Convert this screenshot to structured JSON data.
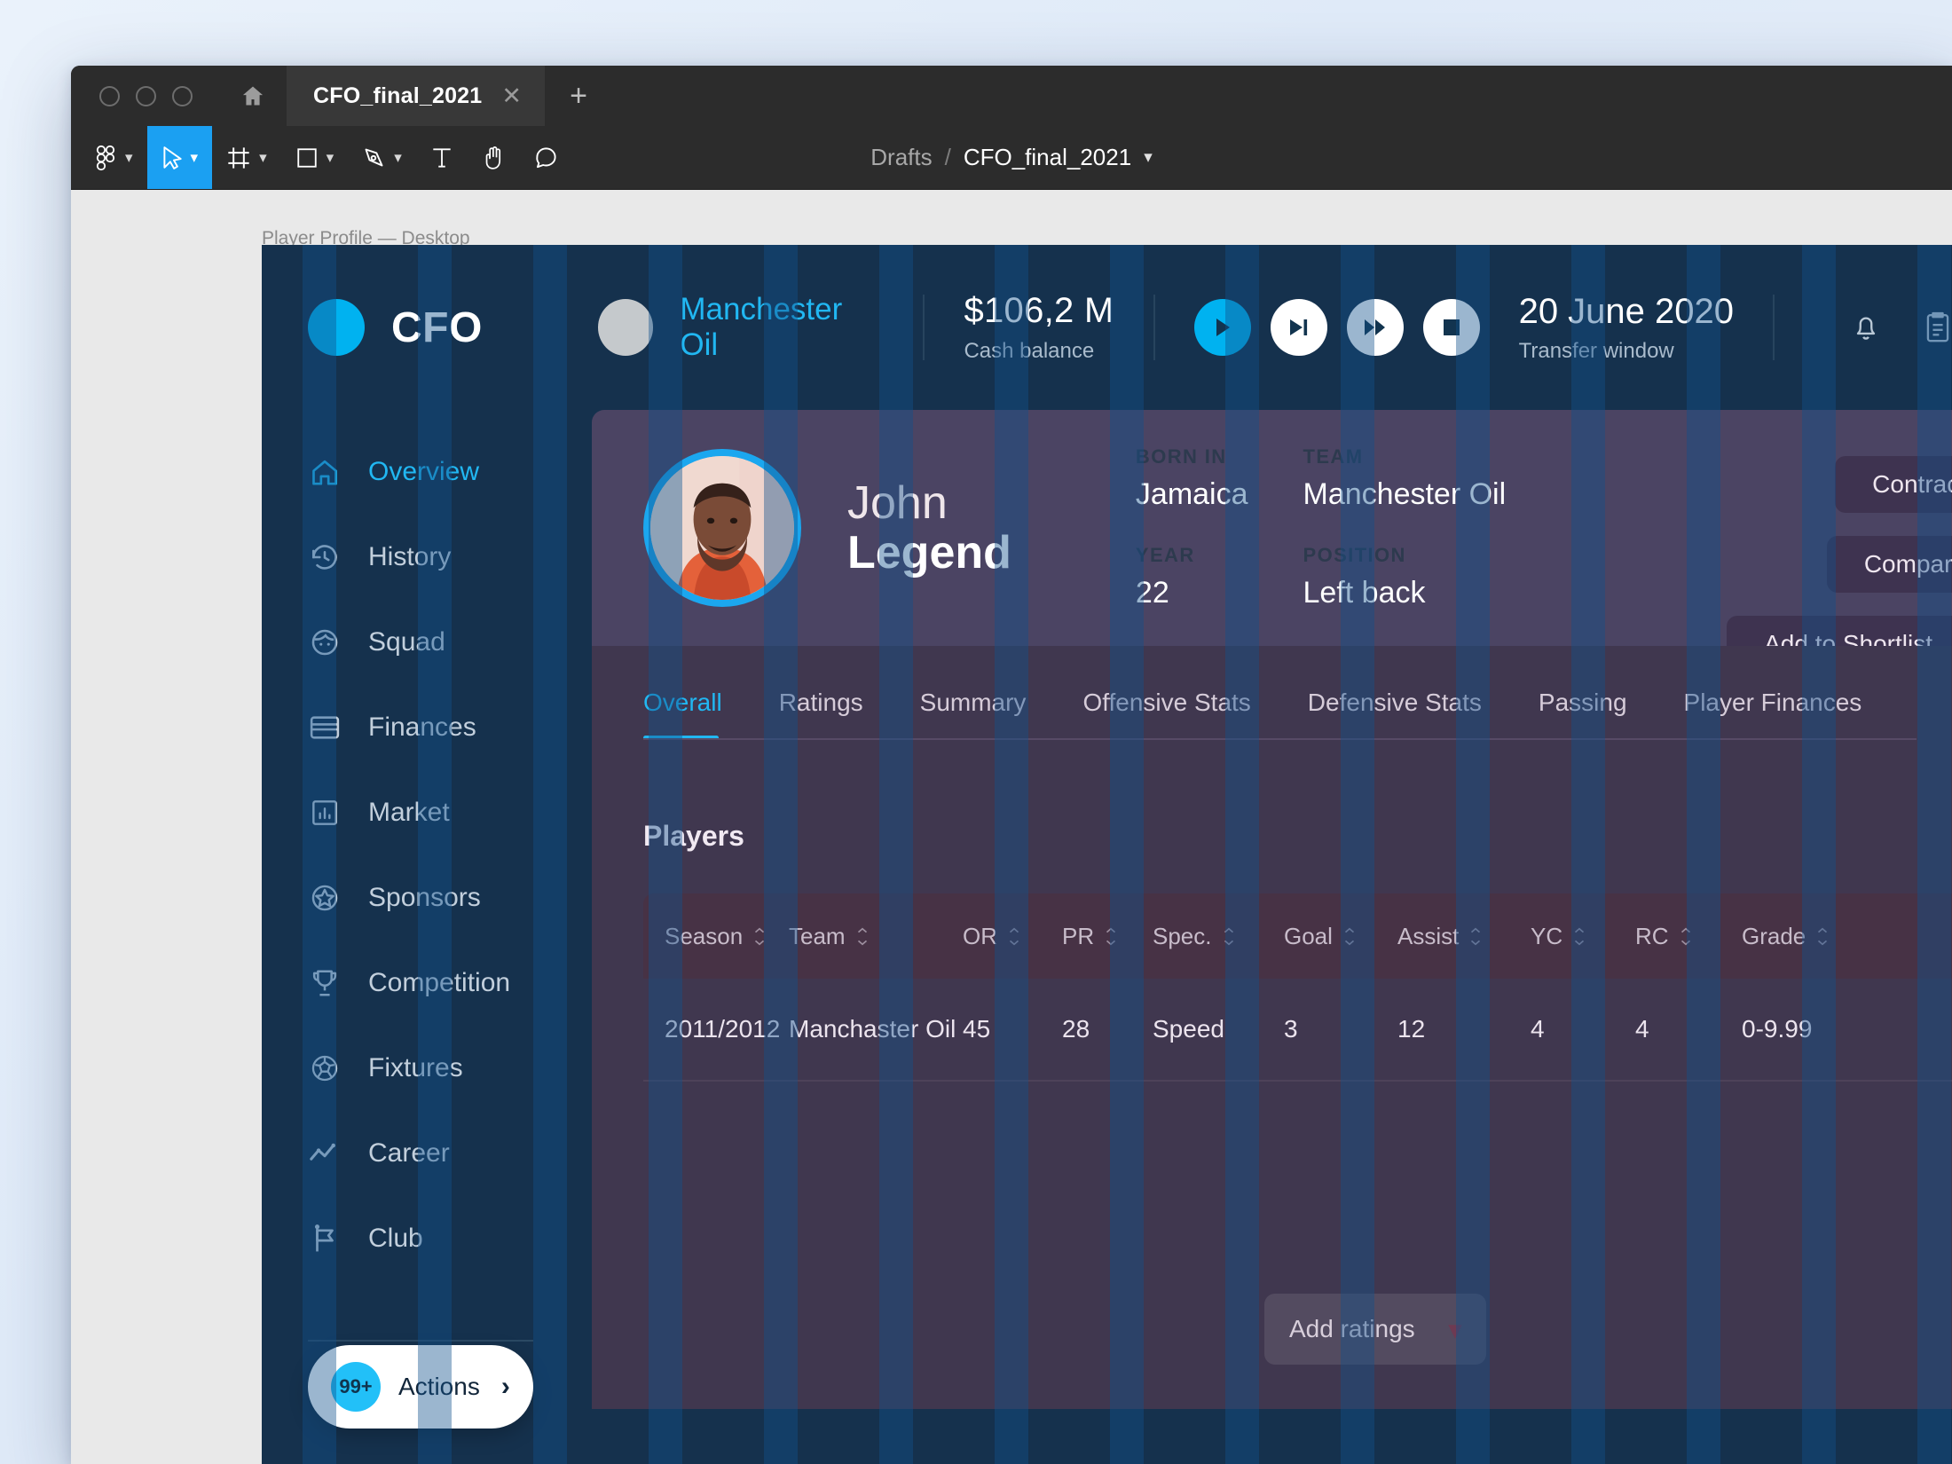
{
  "figma": {
    "tab_title": "CFO_final_2021",
    "close_icon": "close-icon",
    "new_tab_icon": "plus-icon",
    "home_icon": "home-icon",
    "breadcrumb": {
      "project": "Drafts",
      "separator": "/",
      "file": "CFO_final_2021"
    },
    "tools": [
      {
        "name": "figma-menu-icon",
        "caret": true
      },
      {
        "name": "move-tool-icon",
        "caret": true,
        "active": true
      },
      {
        "name": "frame-tool-icon",
        "caret": true
      },
      {
        "name": "shape-tool-icon",
        "caret": true
      },
      {
        "name": "pen-tool-icon",
        "caret": true
      },
      {
        "name": "text-tool-icon",
        "caret": false
      },
      {
        "name": "hand-tool-icon",
        "caret": false
      },
      {
        "name": "comment-tool-icon",
        "caret": false
      }
    ],
    "frame_label": "Player Profile — Desktop"
  },
  "header": {
    "logo_text": "CFO",
    "club_name": "Manchester Oil",
    "cash_value": "$106,2 M",
    "cash_label": "Cash balance",
    "transport": [
      {
        "name": "play-button",
        "icon": "play-icon"
      },
      {
        "name": "step-forward-button",
        "icon": "skip-next-icon"
      },
      {
        "name": "fast-forward-button",
        "icon": "fast-forward-icon"
      },
      {
        "name": "stop-button",
        "icon": "stop-icon"
      }
    ],
    "date_value": "20 June 2020",
    "date_label": "Transfer window",
    "icons": [
      {
        "name": "notifications-bell-icon"
      },
      {
        "name": "clipboard-icon"
      }
    ]
  },
  "sidebar": {
    "items": [
      {
        "label": "Overview",
        "icon": "home-icon",
        "active": true
      },
      {
        "label": "History",
        "icon": "history-icon",
        "active": false
      },
      {
        "label": "Squad",
        "icon": "face-icon",
        "active": false
      },
      {
        "label": "Finances",
        "icon": "credit-card-icon",
        "active": false
      },
      {
        "label": "Market",
        "icon": "bar-chart-icon",
        "active": false
      },
      {
        "label": "Sponsors",
        "icon": "star-badge-icon",
        "active": false
      },
      {
        "label": "Competition",
        "icon": "trophy-icon",
        "active": false
      },
      {
        "label": "Fixtures",
        "icon": "soccer-ball-icon",
        "active": false
      },
      {
        "label": "Career",
        "icon": "trend-line-icon",
        "active": false
      },
      {
        "label": "Club",
        "icon": "flag-icon",
        "active": false
      }
    ],
    "actions": {
      "badge": "99+",
      "label": "Actions",
      "chevron_icon": "chevron-right-icon"
    }
  },
  "profile": {
    "avatar": "player-avatar",
    "first_name": "John",
    "last_name": "Legend",
    "facts": [
      {
        "label": "BORN IN",
        "value": "Jamaica"
      },
      {
        "label": "TEAM",
        "value": "Manchester Oil"
      },
      {
        "label": "YEAR",
        "value": "22"
      },
      {
        "label": "POSITION",
        "value": "Left back"
      }
    ],
    "buttons": [
      {
        "label": "Contract"
      },
      {
        "label": "Compare"
      },
      {
        "label": "Add to Shortlist"
      }
    ]
  },
  "tabs": [
    {
      "label": "Overall",
      "active": true
    },
    {
      "label": "Ratings",
      "active": false
    },
    {
      "label": "Summary",
      "active": false
    },
    {
      "label": "Offensive Stats",
      "active": false
    },
    {
      "label": "Defensive Stats",
      "active": false
    },
    {
      "label": "Passing",
      "active": false
    },
    {
      "label": "Player Finances",
      "active": false
    }
  ],
  "table": {
    "title": "Players",
    "columns": [
      "Season",
      "Team",
      "",
      "OR",
      "PR",
      "Spec.",
      "Goal",
      "Assist",
      "YC",
      "RC",
      "Grade"
    ],
    "rows": [
      {
        "season": "2011/2012",
        "team": "Manchaster Oil",
        "or": "45",
        "pr": "28",
        "spec": "Speed",
        "goal": "3",
        "assist": "12",
        "yc": "4",
        "rc": "4",
        "grade": "0-9.99"
      }
    ],
    "add_ratings": {
      "label": "Add ratings",
      "chevron_icon": "chevron-down-icon"
    }
  },
  "colors": {
    "accent": "#21b7f2",
    "header_bg": "#15314d",
    "panel_bg": "#40374f",
    "hero_bg": "#4b4463",
    "grid_stripe": "#10508c"
  }
}
